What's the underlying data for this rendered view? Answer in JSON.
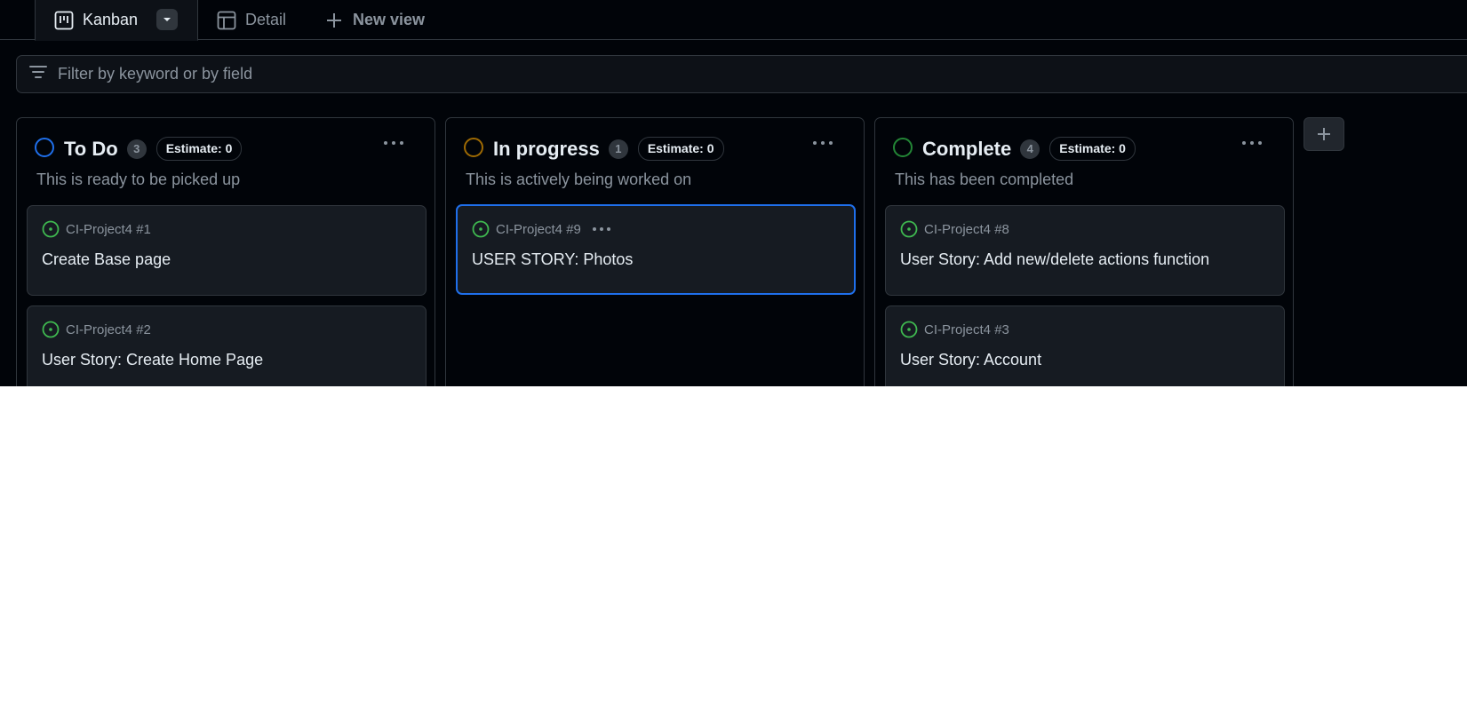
{
  "tabs": {
    "kanban": "Kanban",
    "detail": "Detail",
    "new_view": "New view"
  },
  "filter": {
    "placeholder": "Filter by keyword or by field"
  },
  "columns": [
    {
      "title": "To Do",
      "count": "3",
      "estimate": "Estimate: 0",
      "description": "This is ready to be picked up",
      "color": "#1f6feb",
      "cards": [
        {
          "ref": "CI-Project4 #1",
          "title": "Create Base page"
        },
        {
          "ref": "CI-Project4 #2",
          "title": "User Story: Create Home Page"
        }
      ]
    },
    {
      "title": "In progress",
      "count": "1",
      "estimate": "Estimate: 0",
      "description": "This is actively being worked on",
      "color": "#9e6a03",
      "cards": [
        {
          "ref": "CI-Project4 #9",
          "title": "USER STORY: Photos"
        }
      ]
    },
    {
      "title": "Complete",
      "count": "4",
      "estimate": "Estimate: 0",
      "description": "This has been completed",
      "color": "#238636",
      "cards": [
        {
          "ref": "CI-Project4 #8",
          "title": "User Story: Add new/delete actions function"
        },
        {
          "ref": "CI-Project4 #3",
          "title": "User Story: Account"
        }
      ]
    }
  ],
  "colors": {
    "background": "#010409",
    "card": "#161b22",
    "border": "#30363d",
    "accent": "#1f6feb",
    "open_issue": "#3fb950"
  },
  "icons": {
    "kanban_tab": "project-board-icon",
    "detail_tab": "table-icon",
    "new_view": "plus-icon",
    "filter": "filter-icon",
    "issue": "issue-opened-icon",
    "menu": "kebab-horizontal-icon",
    "add_column": "plus-icon"
  }
}
